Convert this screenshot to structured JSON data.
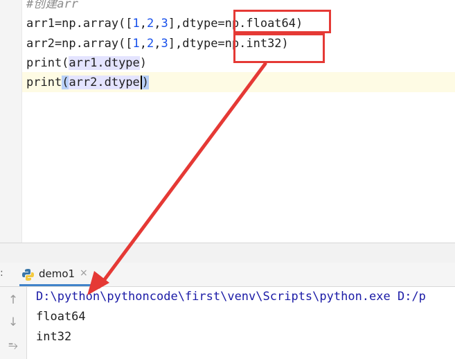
{
  "editor": {
    "comment": "#创建arr",
    "line1": {
      "pre": "arr1=np.array([",
      "n1": "1",
      "c1": ",",
      "n2": "2",
      "c2": ",",
      "n3": "3",
      "post": "],dtype=np.float64)"
    },
    "line2": {
      "pre": "arr2=np.array([",
      "n1": "1",
      "c1": ",",
      "n2": "2",
      "c2": ",",
      "n3": "3",
      "post": "],dtype=np.int32)"
    },
    "line3": {
      "fn": "print(",
      "arg": "arr1.dtype",
      "close": ")"
    },
    "line4": {
      "fn": "print",
      "open": "(",
      "arg": "arr2.dtype",
      "close": ")"
    }
  },
  "run_panel": {
    "colon": ":",
    "tab_label": "demo1",
    "tab_close": "×",
    "tools": {
      "up": "↑",
      "down": "↓",
      "wrap": "⥱"
    }
  },
  "console": {
    "command": "D:\\python\\pythoncode\\first\\venv\\Scripts\\python.exe D:/p",
    "out1": "float64",
    "out2": "int32"
  },
  "colors": {
    "annotation": "#e53935",
    "console_command": "#1a1aa6",
    "number": "#1750eb",
    "run_tab_accent": "#4083c9"
  }
}
